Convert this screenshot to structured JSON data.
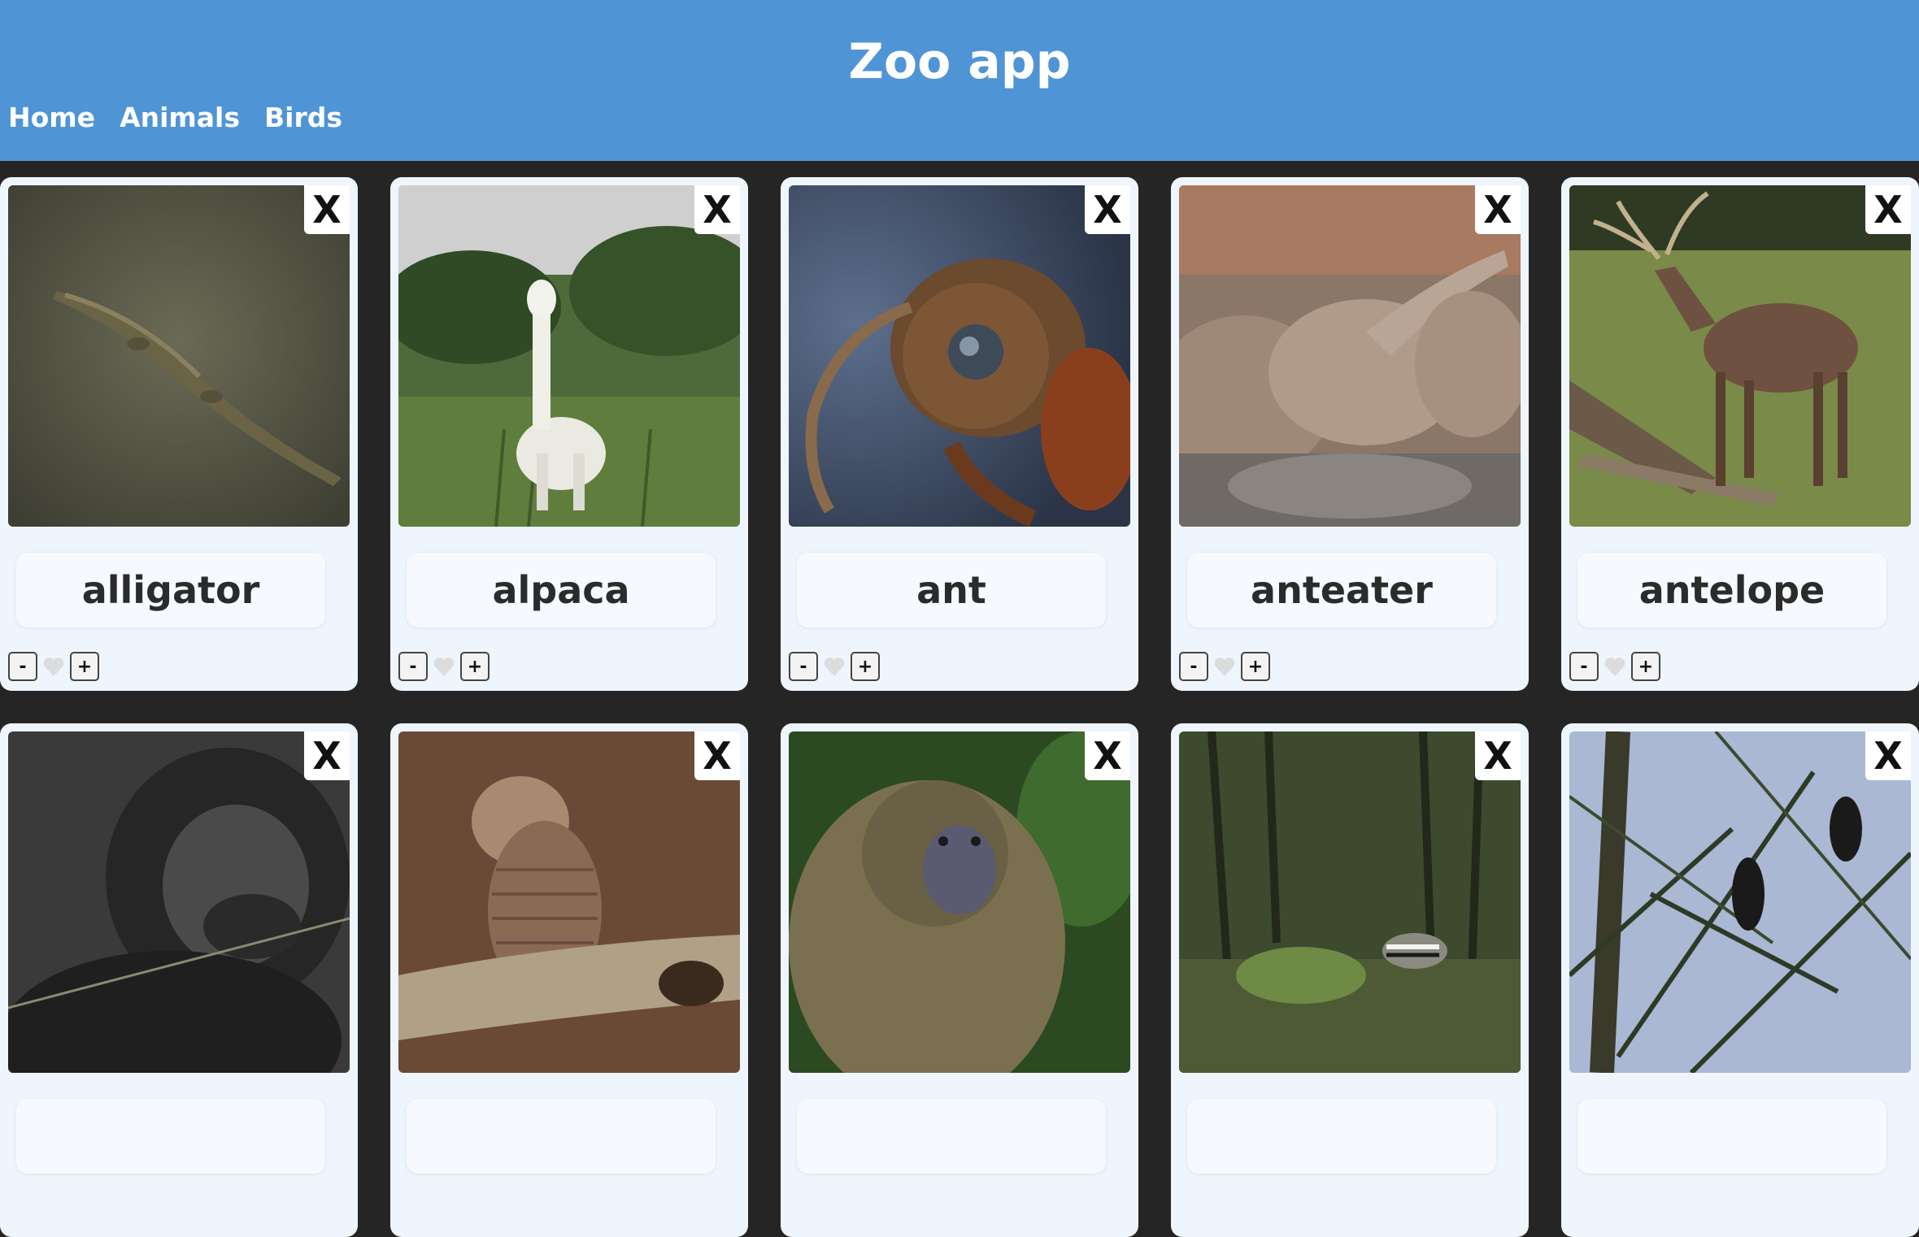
{
  "header": {
    "title": "Zoo app",
    "nav": [
      "Home",
      "Animals",
      "Birds"
    ]
  },
  "cards": [
    {
      "name": "alligator",
      "close_label": "X",
      "minus_label": "-",
      "plus_label": "+",
      "icon": "alligator-photo"
    },
    {
      "name": "alpaca",
      "close_label": "X",
      "minus_label": "-",
      "plus_label": "+",
      "icon": "alpaca-photo"
    },
    {
      "name": "ant",
      "close_label": "X",
      "minus_label": "-",
      "plus_label": "+",
      "icon": "ant-photo"
    },
    {
      "name": "anteater",
      "close_label": "X",
      "minus_label": "-",
      "plus_label": "+",
      "icon": "anteater-photo"
    },
    {
      "name": "antelope",
      "close_label": "X",
      "minus_label": "-",
      "plus_label": "+",
      "icon": "antelope-photo"
    },
    {
      "name": "",
      "close_label": "X",
      "icon": "ape-photo"
    },
    {
      "name": "",
      "close_label": "X",
      "icon": "armadillo-photo"
    },
    {
      "name": "",
      "close_label": "X",
      "icon": "baboon-photo"
    },
    {
      "name": "",
      "close_label": "X",
      "icon": "badger-photo"
    },
    {
      "name": "",
      "close_label": "X",
      "icon": "bat-photo"
    }
  ],
  "colors": {
    "header_bg": "#4f95d6",
    "page_bg": "#252525",
    "card_bg": "#eef5fd",
    "heart": "#dcdcdc"
  }
}
